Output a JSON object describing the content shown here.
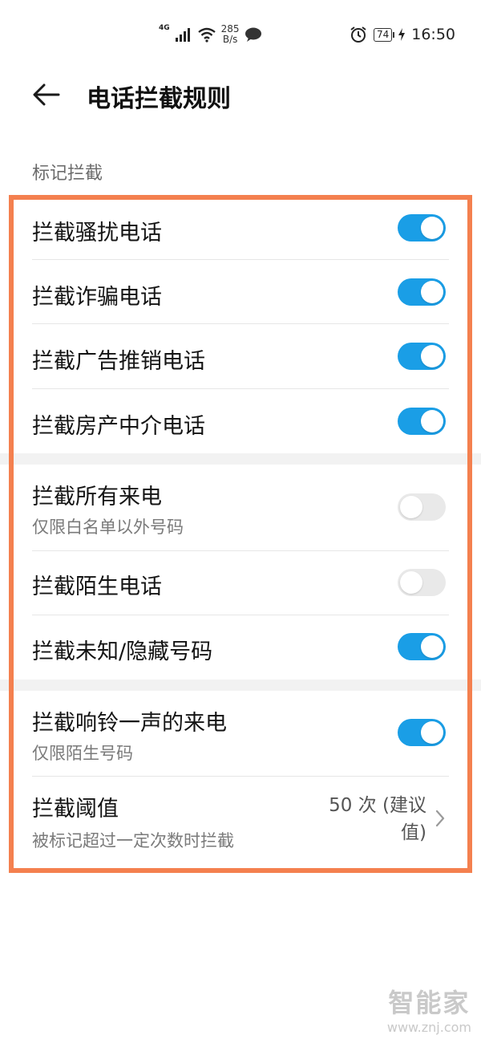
{
  "status_bar": {
    "network": "4G",
    "speed_value": "285",
    "speed_unit": "B/s",
    "battery": "74",
    "time": "16:50",
    "icons": [
      "signal-icon",
      "wifi-icon",
      "message-icon",
      "alarm-icon",
      "battery-icon",
      "charging-icon"
    ]
  },
  "header": {
    "title": "电话拦截规则"
  },
  "section": {
    "label": "标记拦截"
  },
  "settings": [
    {
      "title": "拦截骚扰电话",
      "subtitle": "",
      "on": true
    },
    {
      "title": "拦截诈骗电话",
      "subtitle": "",
      "on": true
    },
    {
      "title": "拦截广告推销电话",
      "subtitle": "",
      "on": true
    },
    {
      "title": "拦截房产中介电话",
      "subtitle": "",
      "on": true
    },
    {
      "title": "拦截所有来电",
      "subtitle": "仅限白名单以外号码",
      "on": false
    },
    {
      "title": "拦截陌生电话",
      "subtitle": "",
      "on": false
    },
    {
      "title": "拦截未知/隐藏号码",
      "subtitle": "",
      "on": true
    },
    {
      "title": "拦截响铃一声的来电",
      "subtitle": "仅限陌生号码",
      "on": true
    }
  ],
  "threshold": {
    "title": "拦截阈值",
    "subtitle": "被标记超过一定次数时拦截",
    "value_line1": "50 次 (建议",
    "value_line2": "值)"
  },
  "colors": {
    "toggle_on": "#1a9ee6",
    "toggle_off": "#e9e9e9",
    "highlight": "#f4804f"
  },
  "watermark": {
    "brand": "智能家",
    "url": "www.znj.com"
  }
}
